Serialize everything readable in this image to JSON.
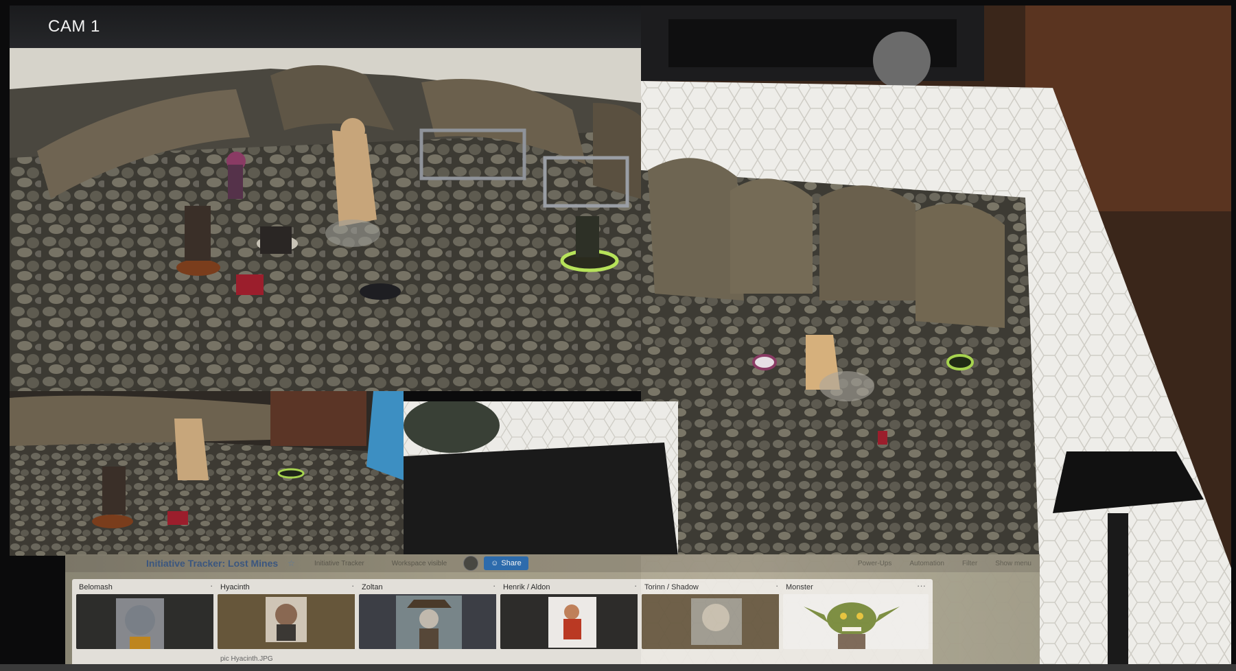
{
  "camera": {
    "label": "CAM 1"
  },
  "tracker": {
    "board_title": "Initiative Tracker: Lost Mines",
    "view_label": "Initiative Tracker",
    "visibility_label": "Workspace visible",
    "share_label": "Share",
    "header_actions": [
      "Power-Ups",
      "Automation",
      "Filter",
      "Show menu"
    ],
    "lists": [
      {
        "name": "Belomash",
        "card_caption": ""
      },
      {
        "name": "Hyacinth",
        "card_caption": "pic Hyacinth.JPG"
      },
      {
        "name": "Zoltan",
        "card_caption": ""
      },
      {
        "name": "Henrik / Aldon",
        "card_caption": ""
      },
      {
        "name": "Torinn / Shadow",
        "card_caption": ""
      },
      {
        "name": "Monster",
        "card_caption": ""
      }
    ]
  },
  "colors": {
    "share_button": "#2f6fb3",
    "board_title": "#3d5a84",
    "cobblestone": "#5c5a52",
    "table_mat": "#e9e8e3"
  }
}
